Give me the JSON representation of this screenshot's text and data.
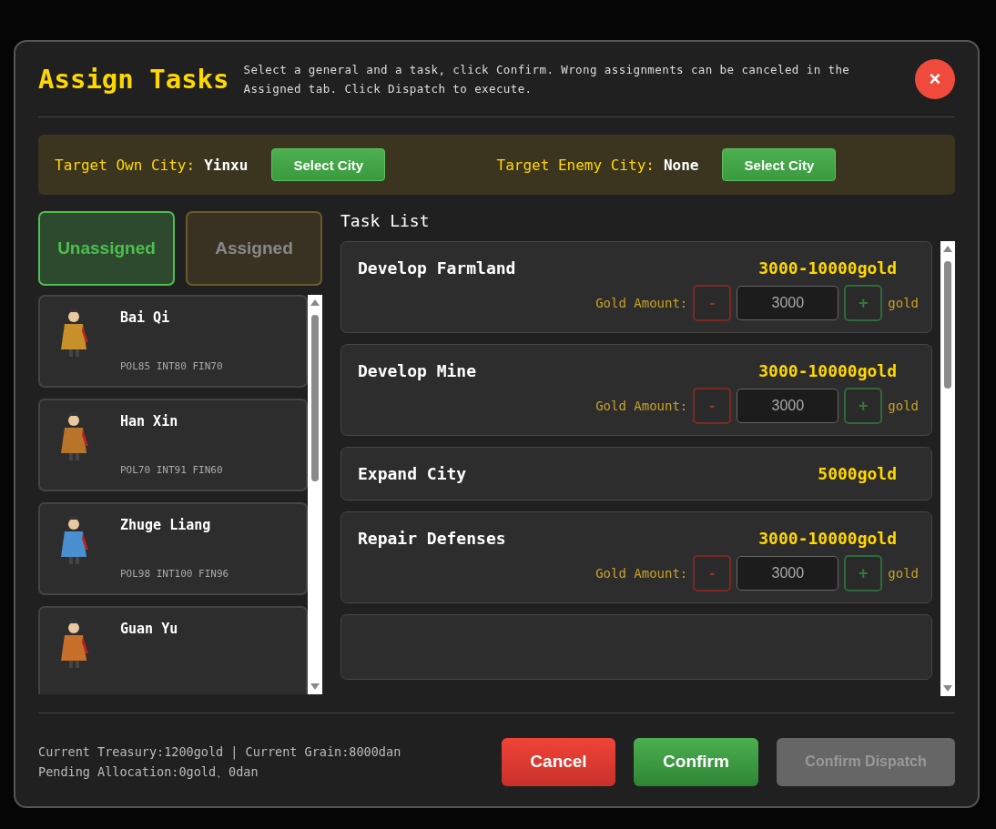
{
  "dialog": {
    "title": "Assign Tasks",
    "instructions": "Select a general and a task, click Confirm. Wrong assignments can be canceled in the Assigned tab. Click Dispatch to execute.",
    "close_label": "×"
  },
  "targets": [
    {
      "label": "Target Own City:",
      "value": "Yinxu",
      "button": "Select City"
    },
    {
      "label": "Target Enemy City:",
      "value": "None",
      "button": "Select City"
    }
  ],
  "tabs": [
    {
      "label": "Unassigned",
      "selected": true
    },
    {
      "label": "Assigned",
      "selected": false
    }
  ],
  "generals": [
    {
      "name": "Bai Qi",
      "stats": "POL85 INT80 FIN70",
      "color": "#c8902a"
    },
    {
      "name": "Han Xin",
      "stats": "POL70 INT91 FIN60",
      "color": "#b8752a"
    },
    {
      "name": "Zhuge Liang",
      "stats": "POL98 INT100 FIN96",
      "color": "#4a8fd0"
    },
    {
      "name": "Guan Yu",
      "color": "#c8702a"
    }
  ],
  "task_list": {
    "title": "Task List",
    "tasks": [
      {
        "kind": "adjustable",
        "name": "Develop Farmland",
        "cost": "3000-10000gold",
        "amount_label": "Gold Amount:",
        "minus": "-",
        "amount": "3000",
        "plus": "+",
        "unit": "gold"
      },
      {
        "kind": "adjustable",
        "name": "Develop Mine",
        "cost": "3000-10000gold",
        "amount_label": "Gold Amount:",
        "minus": "-",
        "amount": "3000",
        "plus": "+",
        "unit": "gold"
      },
      {
        "kind": "fixed",
        "name": "Expand City",
        "cost": "5000gold"
      },
      {
        "kind": "adjustable",
        "name": "Repair Defenses",
        "cost": "3000-10000gold",
        "amount_label": "Gold Amount:",
        "minus": "-",
        "amount": "3000",
        "plus": "+",
        "unit": "gold"
      },
      {
        "kind": "hidden"
      }
    ]
  },
  "footer": {
    "treasury": "Current Treasury:1200gold | Current Grain:8000dan",
    "pending": "Pending Allocation:0gold、0dan"
  },
  "buttons": [
    {
      "label": "Cancel",
      "kind": "danger"
    },
    {
      "label": "Confirm",
      "kind": "primary"
    },
    {
      "label": "Confirm Dispatch",
      "kind": "disabled"
    }
  ]
}
